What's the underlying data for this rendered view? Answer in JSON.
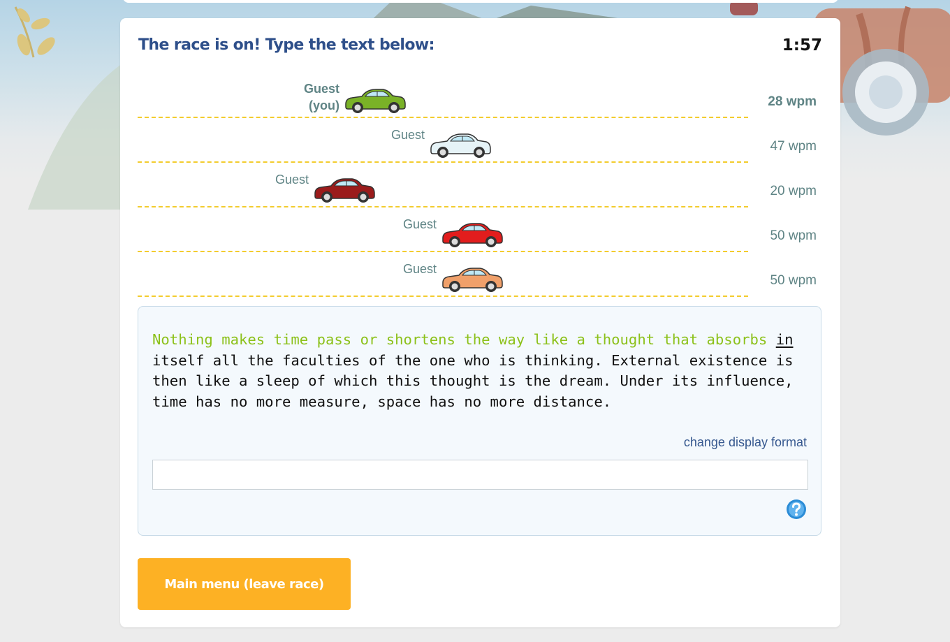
{
  "race": {
    "title": "The race is on! Type the text below:",
    "timer": "1:57"
  },
  "racers": [
    {
      "name": "Guest\n(you)",
      "wpm": "28 wpm",
      "is_you": true,
      "car_color": "#7ab227",
      "progress": 0.44
    },
    {
      "name": "Guest",
      "wpm": "47 wpm",
      "is_you": false,
      "car_color": "#e6f3f7",
      "progress": 0.58
    },
    {
      "name": "Guest",
      "wpm": "20 wpm",
      "is_you": false,
      "car_color": "#9b1b1b",
      "progress": 0.39
    },
    {
      "name": "Guest",
      "wpm": "50 wpm",
      "is_you": false,
      "car_color": "#e21d1d",
      "progress": 0.6
    },
    {
      "name": "Guest",
      "wpm": "50 wpm",
      "is_you": false,
      "car_color": "#f0a06a",
      "progress": 0.6
    }
  ],
  "passage": {
    "typed": "Nothing makes time pass or shortens the way like a thought that absorbs ",
    "current_word": "in",
    "remaining": " itself all the faculties of the one who is thinking. External existence is then like a sleep of which this thought is the dream. Under its influence, time has no more measure, space has no more distance."
  },
  "format_link": "change display format",
  "input": {
    "value": "",
    "placeholder": ""
  },
  "help_icon": "help-icon",
  "main_menu_button": "Main menu (leave race)",
  "colors": {
    "title": "#2e4f8a",
    "lane_line": "#f3cc2e",
    "typed_text": "#8cc11a",
    "button": "#fdb124",
    "racer_text": "#5f8485"
  }
}
